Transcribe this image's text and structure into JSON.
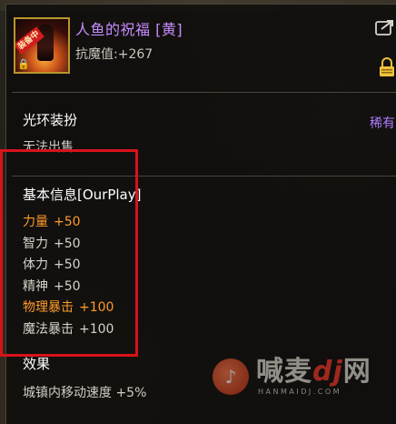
{
  "item": {
    "name": "人鱼的祝福 [黄]",
    "subline": "抗魔值:+267",
    "icon_badge": "装备中",
    "icon": "mermaid-blessing-icon"
  },
  "header_icons": {
    "share": "share-icon",
    "lock": "lock-icon"
  },
  "category": {
    "title": "光环装扮",
    "rarity": "稀有",
    "trade_status": "无法出售"
  },
  "basic_info": {
    "title": "基本信息[OurPlay]",
    "stats": [
      {
        "name": "力量",
        "value": "+50",
        "highlight": true
      },
      {
        "name": "智力",
        "value": "+50",
        "highlight": false
      },
      {
        "name": "体力",
        "value": "+50",
        "highlight": false
      },
      {
        "name": "精神",
        "value": "+50",
        "highlight": false
      },
      {
        "name": "物理暴击",
        "value": "+100",
        "highlight": true
      },
      {
        "name": "魔法暴击",
        "value": "+100",
        "highlight": false
      }
    ]
  },
  "effect": {
    "title": "效果",
    "line": "城镇内移动速度 +5%"
  },
  "watermark": {
    "text_main": "喊麦",
    "text_dj": "dj",
    "text_net": "网",
    "url": "HANMAIDJ.COM"
  },
  "colors": {
    "name_purple": "#c88cff",
    "rarity_purple": "#b07cff",
    "stat_orange": "#ff9a2a",
    "highlight_red": "#d8121a",
    "icon_border_gold": "#b8962e"
  }
}
